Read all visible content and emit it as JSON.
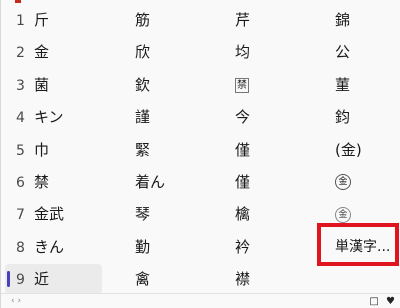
{
  "candidates": [
    {
      "num": "1",
      "col0": "斤",
      "col1": "筋",
      "col2": "芹",
      "col3": "錦"
    },
    {
      "num": "2",
      "col0": "金",
      "col1": "欣",
      "col2": "均",
      "col3": "公"
    },
    {
      "num": "3",
      "col0": "菌",
      "col1": "欽",
      "col2": "禁",
      "col3": "菫"
    },
    {
      "num": "4",
      "col0": "キン",
      "col1": "謹",
      "col2": "今",
      "col3": "鈞"
    },
    {
      "num": "5",
      "col0": "巾",
      "col1": "緊",
      "col2": "僅",
      "col3": "(金)"
    },
    {
      "num": "6",
      "col0": "禁",
      "col1": "着ん",
      "col2": "僅",
      "col3": "金"
    },
    {
      "num": "7",
      "col0": "金武",
      "col1": "琴",
      "col2": "檎",
      "col3": "金"
    },
    {
      "num": "8",
      "col0": "きん",
      "col1": "勤",
      "col2": "衿",
      "col3": "単漢字..."
    },
    {
      "num": "9",
      "col0": "近",
      "col1": "禽",
      "col2": "襟",
      "col3": ""
    }
  ],
  "selected_index": 9,
  "accent_color": "#4a3fb8",
  "highlight_color": "#e0141e",
  "footer": {
    "left_glyph": "‹ ›",
    "icons": "□ ♥"
  }
}
